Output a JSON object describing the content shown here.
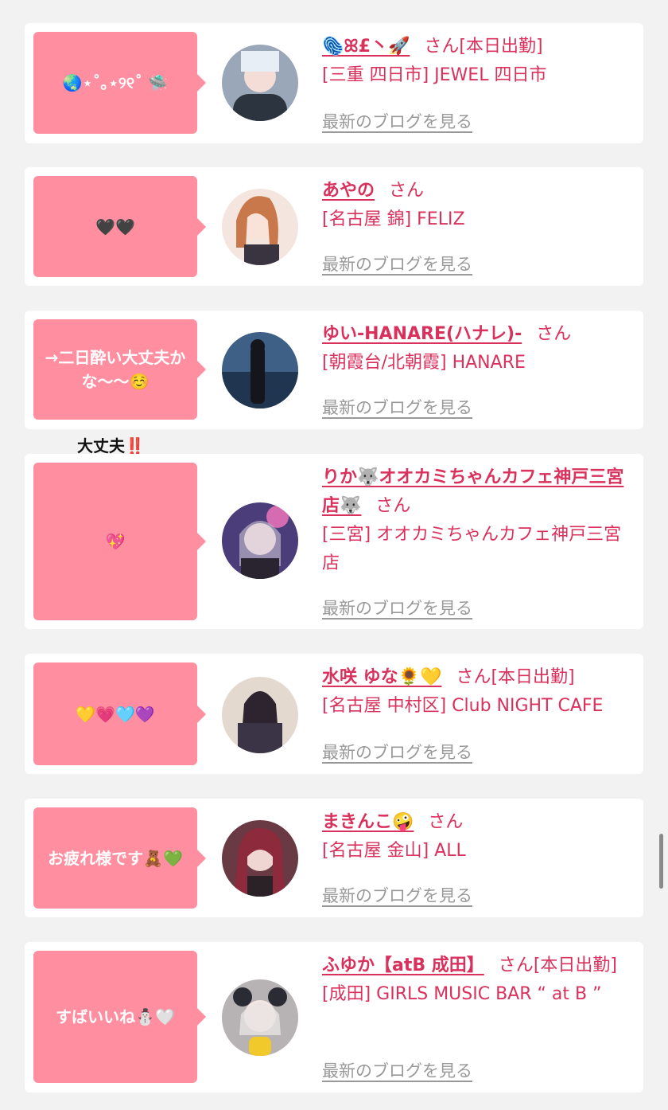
{
  "blog_link_label": "最新のブログを見る",
  "san_label": "さん",
  "working_today_label": "[本日出勤]",
  "annotation": "大丈夫‼️",
  "colors": {
    "bubble": "#ff8fa0",
    "accent": "#d9315c",
    "link_gray": "#999999",
    "background": "#f2f2f2"
  },
  "cards": [
    {
      "comment": "🌏⋆˚｡⋆୨୧˚ 🛸",
      "name": "🫆ꕤ£丶🚀",
      "working_today": true,
      "shop": "[三重 四日市] JEWEL 四日市",
      "avatar_icon": "avatar-photo"
    },
    {
      "comment": "🖤🖤",
      "name": "あやの",
      "working_today": false,
      "shop": "[名古屋 錦] FELIZ",
      "avatar_icon": "avatar-photo"
    },
    {
      "comment": "→二日酔い大丈夫かな〜〜☺️",
      "name": "ゆい-HANARE(ハナレ)-",
      "working_today": false,
      "shop": "[朝霞台/北朝霞] HANARE",
      "avatar_icon": "avatar-photo"
    },
    {
      "comment": "💖",
      "name": "りか🐺オオカミちゃんカフェ神戸三宮店🐺",
      "working_today": false,
      "shop": "[三宮] オオカミちゃんカフェ神戸三宮店",
      "avatar_icon": "avatar-photo"
    },
    {
      "comment": "💛💗🩵💜",
      "name": "水咲 ゆな🌻💛",
      "working_today": true,
      "shop": "[名古屋 中村区] Club NIGHT CAFE",
      "avatar_icon": "avatar-photo"
    },
    {
      "comment": "お疲れ様です🧸💚",
      "name": "まきんこ🤪",
      "working_today": false,
      "shop": "[名古屋 金山] ALL",
      "avatar_icon": "avatar-photo"
    },
    {
      "comment": "すばいいね⛄️🤍",
      "name": "ふゆか【atB 成田】",
      "working_today": true,
      "shop": "[成田] GIRLS MUSIC BAR “ at B ”",
      "avatar_icon": "avatar-photo"
    }
  ]
}
